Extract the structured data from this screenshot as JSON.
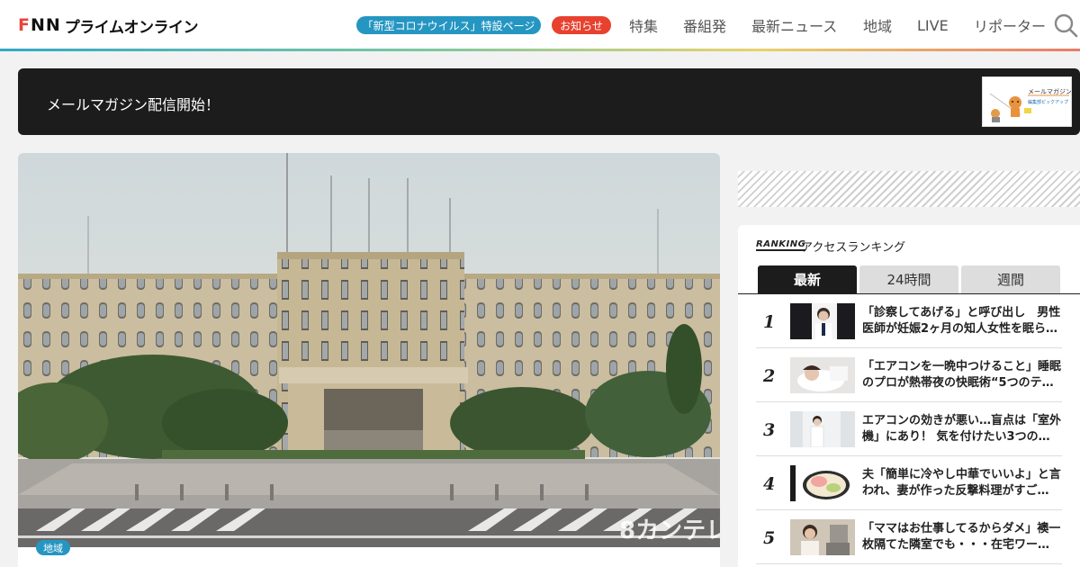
{
  "header": {
    "logo_fnn": "FNN",
    "logo_text": "プライムオンライン",
    "corona_label": "「新型コロナウイルス」特設ページ",
    "notice_label": "お知らせ",
    "nav": [
      "特集",
      "番組発",
      "最新ニュース",
      "地域",
      "LIVE",
      "リポーター"
    ],
    "search_icon": "search-icon",
    "accent_colors": [
      "#2596c2",
      "#e8412f"
    ]
  },
  "banner": {
    "text": "メールマガジン配信開始！",
    "thumb_text": "メールマガジン",
    "thumb_subtext": "編集部ピックアップ"
  },
  "article": {
    "category": "地域",
    "watermark": "8カンテレ"
  },
  "ranking": {
    "logo": "RANKING",
    "title": "アクセスランキング",
    "tabs": [
      "最新",
      "24時間",
      "週間"
    ],
    "active_tab": "最新",
    "items": [
      {
        "rank": "1",
        "text": "「診察してあげる」と呼び出し　男性医師が妊娠2ヶ月の知人女性を眠らせ…"
      },
      {
        "rank": "2",
        "text": "「エアコンを一晩中つけること」睡眠のプロが熱帯夜の快眠術“5つのテ…"
      },
      {
        "rank": "3",
        "text": "エアコンの効きが悪い…盲点は「室外機」にあり！ 気を付けたい3つの…"
      },
      {
        "rank": "4",
        "text": "夫「簡単に冷やし中華でいいよ」と言われ、妻が作った反撃料理がすご…"
      },
      {
        "rank": "5",
        "text": "「ママはお仕事してるからダメ」襖一枚隔てた隣室でも・・・在宅ワー…"
      }
    ]
  }
}
